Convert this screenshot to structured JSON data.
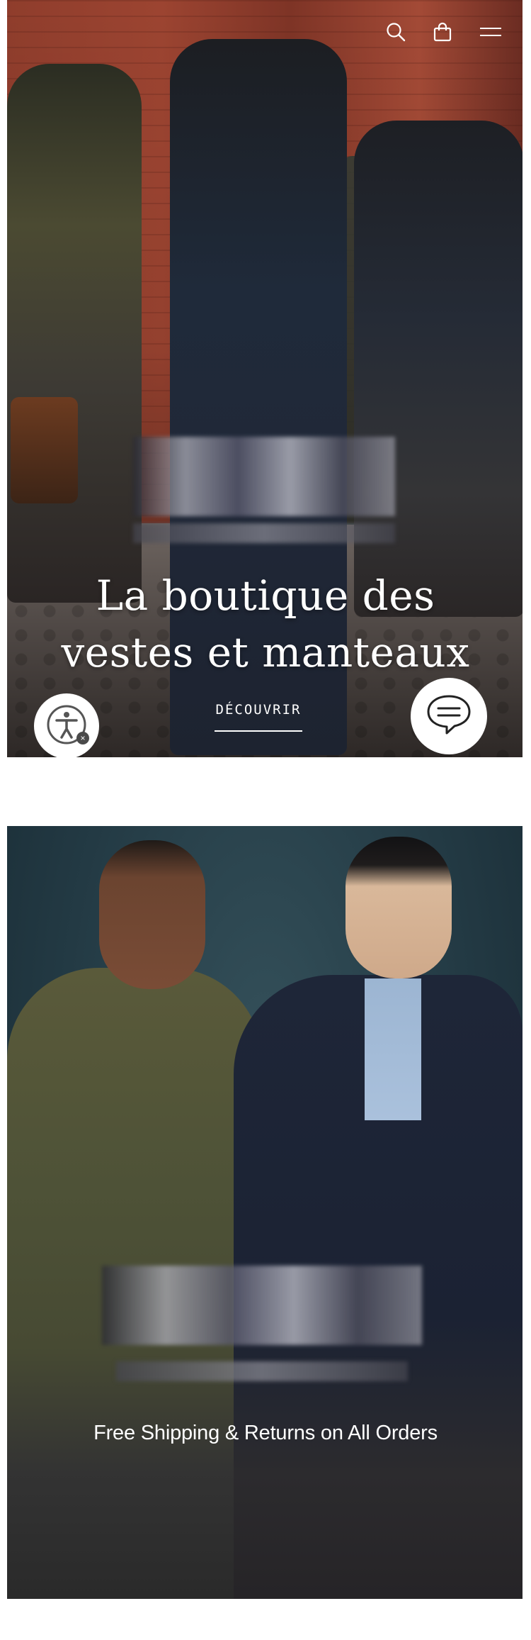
{
  "header": {
    "search_icon": "search-icon",
    "cart_icon": "shopping-bag-icon",
    "menu_icon": "hamburger-menu-icon"
  },
  "hero": {
    "title_line1": "La boutique des",
    "title_line2": "vestes et manteaux",
    "cta_label": "DÉCOUVRIR"
  },
  "widgets": {
    "accessibility_icon": "accessibility-icon",
    "chat_icon": "chat-bubble-icon"
  },
  "promo": {
    "text": "Free Shipping & Returns on All Orders"
  },
  "colors": {
    "text_on_image": "#ffffff",
    "page_background": "#ffffff"
  }
}
